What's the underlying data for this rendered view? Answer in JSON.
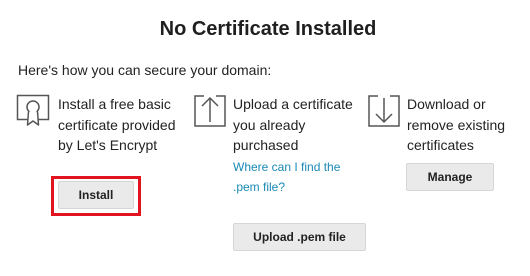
{
  "header": {
    "title": "No Certificate Installed",
    "intro": "Here's how you can secure your domain:"
  },
  "options": [
    {
      "icon": "certificate-icon",
      "description": "Install a free basic certificate provided by Let's Encrypt",
      "button_label": "Install",
      "highlighted": true
    },
    {
      "icon": "upload-icon",
      "description": "Upload a certificate you already purchased",
      "help_link": "Where can I find the .pem file?",
      "button_label": "Upload .pem file"
    },
    {
      "icon": "download-icon",
      "description": "Download or remove existing certificates",
      "button_label": "Manage"
    }
  ],
  "colors": {
    "link": "#1a8ab5",
    "highlight": "#e0131f",
    "button_bg": "#eaeaea"
  }
}
